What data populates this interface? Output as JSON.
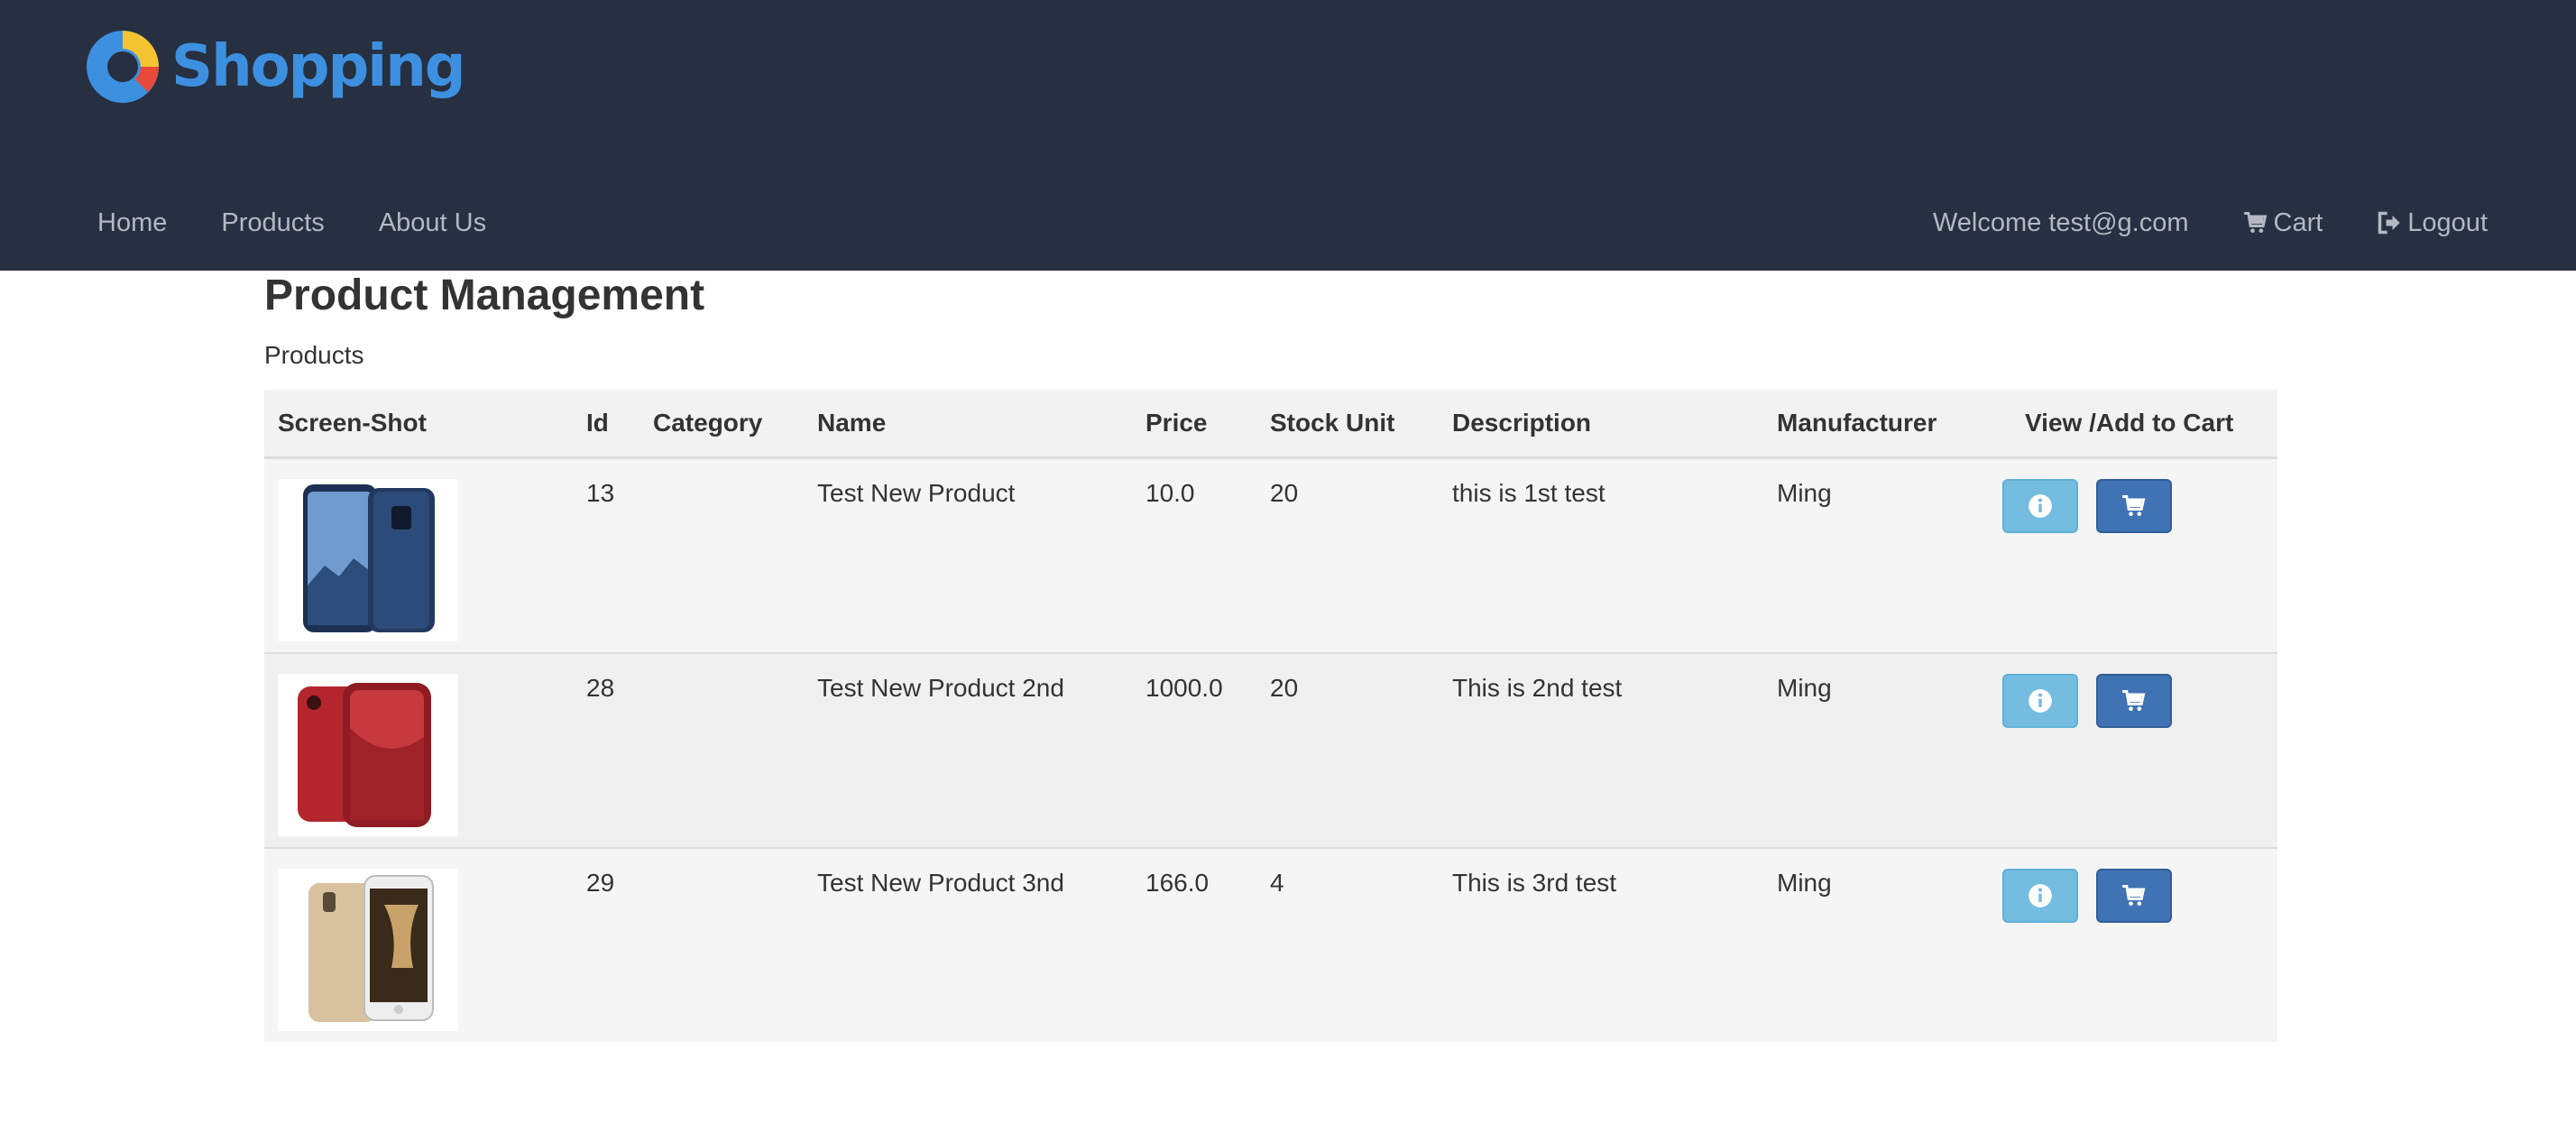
{
  "header": {
    "brand": "Shopping",
    "nav_left": [
      "Home",
      "Products",
      "About Us"
    ],
    "welcome": "Welcome test@g.com",
    "cart_label": "Cart",
    "logout_label": "Logout"
  },
  "page": {
    "title": "Product Management",
    "subtitle": "Products"
  },
  "table": {
    "columns": [
      "Screen-Shot",
      "Id",
      "Category",
      "Name",
      "Price",
      "Stock Unit",
      "Description",
      "Manufacturer",
      "View /Add to Cart"
    ],
    "rows": [
      {
        "image": "phone-blue-image",
        "id": "13",
        "category": "",
        "name": "Test New Product",
        "price": "10.0",
        "stock": "20",
        "description": "this is 1st test",
        "manufacturer": "Ming"
      },
      {
        "image": "phone-red-image",
        "id": "28",
        "category": "",
        "name": "Test New Product 2nd",
        "price": "1000.0",
        "stock": "20",
        "description": "This is 2nd test",
        "manufacturer": "Ming"
      },
      {
        "image": "phone-gold-image",
        "id": "29",
        "category": "",
        "name": "Test New Product 3nd",
        "price": "166.0",
        "stock": "4",
        "description": "This is 3rd test",
        "manufacturer": "Ming"
      }
    ]
  },
  "colors": {
    "header_bg": "#263040",
    "brand": "#3d8fe0",
    "info_button": "#74bde0",
    "cart_button": "#3f73b3"
  },
  "icons": {
    "view_button": "info-icon",
    "add_button": "cart-icon",
    "nav_cart": "cart-icon",
    "nav_logout": "logout-icon"
  }
}
